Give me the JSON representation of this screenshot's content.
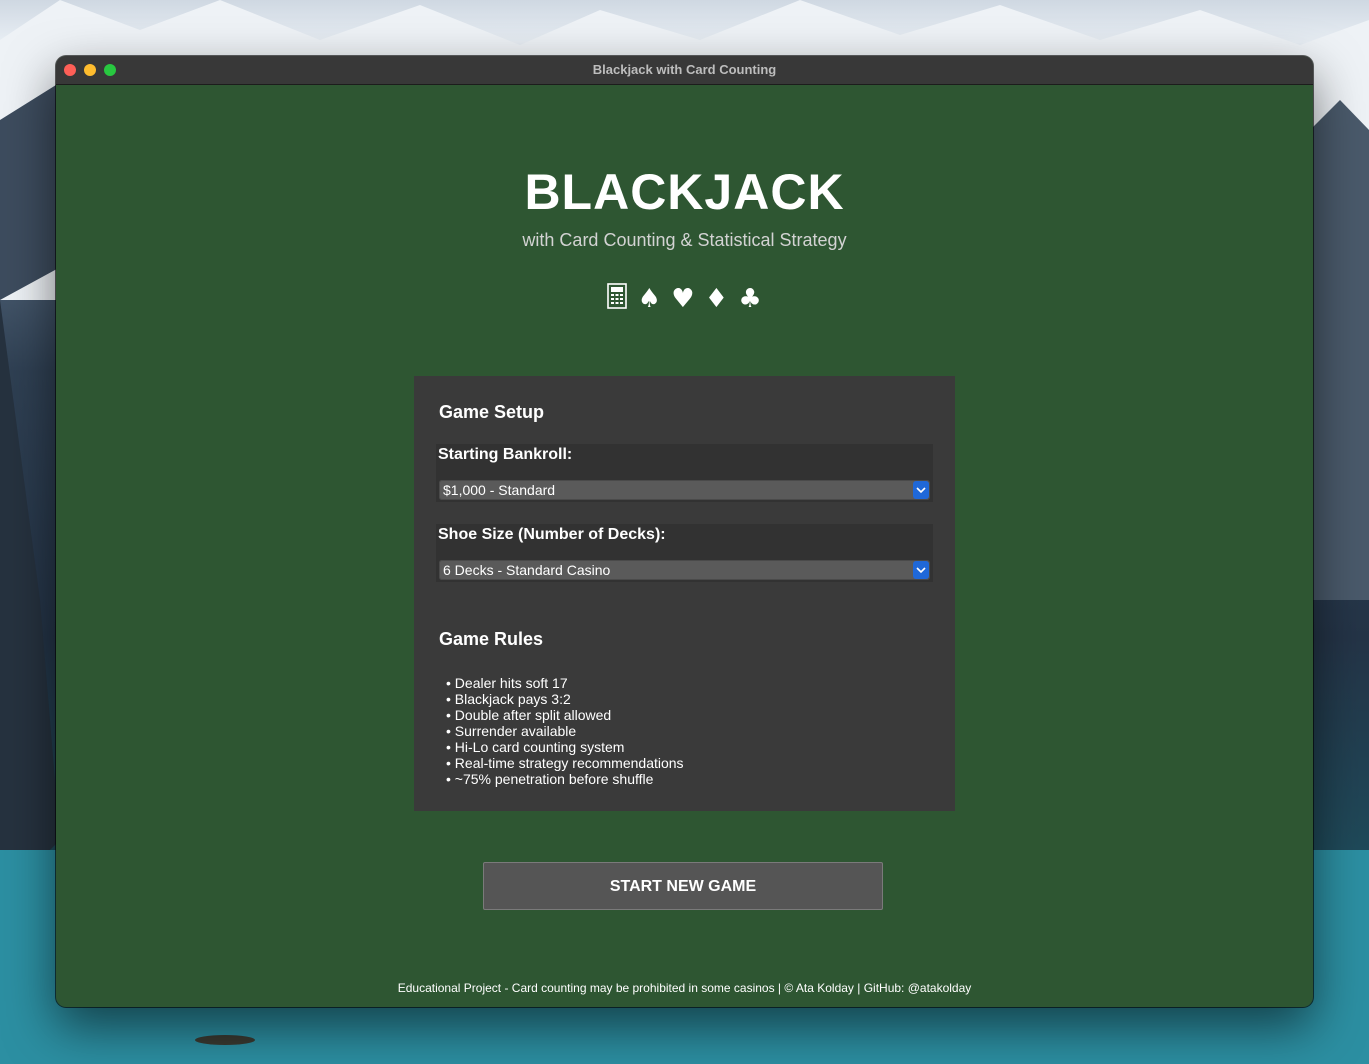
{
  "window": {
    "title": "Blackjack with Card Counting"
  },
  "header": {
    "title": "BLACKJACK",
    "subtitle": "with Card Counting & Statistical Strategy",
    "icons": [
      "abacus-icon",
      "spade-icon",
      "heart-icon",
      "diamond-icon",
      "club-icon"
    ]
  },
  "setup": {
    "heading": "Game Setup",
    "bankroll": {
      "label": "Starting Bankroll:",
      "value": "$1,000 - Standard"
    },
    "shoe": {
      "label": "Shoe Size (Number of Decks):",
      "value": "6 Decks - Standard Casino"
    }
  },
  "rules": {
    "heading": "Game Rules",
    "items": [
      "Dealer hits soft 17",
      "Blackjack pays 3:2",
      "Double after split allowed",
      "Surrender available",
      "Hi-Lo card counting system",
      "Real-time strategy recommendations",
      "~75% penetration before shuffle"
    ]
  },
  "actions": {
    "start_label": "START NEW GAME"
  },
  "footer": {
    "text": "Educational Project - Card counting may be prohibited in some casinos | © Ata Kolday | GitHub: @atakolday"
  },
  "colors": {
    "felt": "#2e5632",
    "panel": "#3a3a3a",
    "select_accent": "#1f68d8"
  }
}
